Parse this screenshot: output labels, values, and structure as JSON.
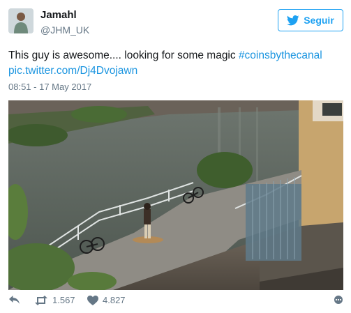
{
  "author": {
    "name": "Jamahl",
    "handle": "@JHM_UK"
  },
  "follow_button": {
    "label": "Seguir",
    "icon": "twitter-bird-icon"
  },
  "tweet": {
    "text_plain": "This guy is awesome.... looking for some magic ",
    "hashtag": "#coinsbythecanal",
    "media_link": "pic.twitter.com/Dj4Dvojawn",
    "timestamp": "08:51 - 17 May 2017"
  },
  "actions": {
    "reply_icon": "reply-icon",
    "retweet_icon": "retweet-icon",
    "retweet_count": "1.567",
    "like_icon": "heart-icon",
    "like_count": "4.827",
    "more_icon": "more-icon"
  },
  "colors": {
    "accent": "#1da1f2",
    "link": "#1b95e0",
    "muted": "#657786",
    "text": "#14171a"
  }
}
